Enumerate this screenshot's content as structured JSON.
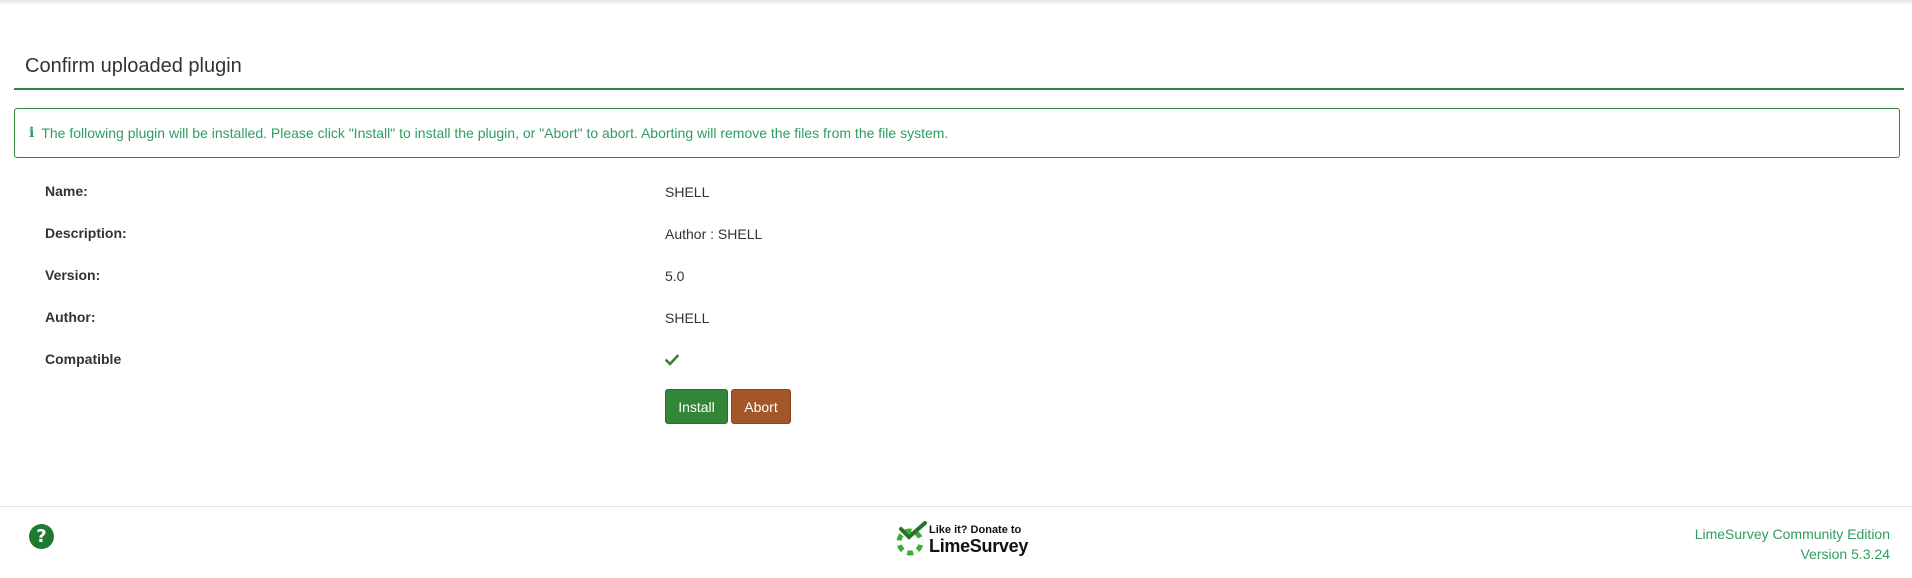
{
  "page": {
    "title": "Confirm uploaded plugin"
  },
  "alert": {
    "icon": "info-icon",
    "text": "The following plugin will be installed. Please click \"Install\" to install the plugin, or \"Abort\" to abort. Aborting will remove the files from the file system."
  },
  "plugin": {
    "fields": [
      {
        "label": "Name:",
        "value": "SHELL"
      },
      {
        "label": "Description:",
        "value": "Author : SHELL"
      },
      {
        "label": "Version:",
        "value": "5.0"
      },
      {
        "label": "Author:",
        "value": "SHELL"
      },
      {
        "label": "Compatible",
        "value_icon": "check-icon"
      }
    ]
  },
  "actions": {
    "install_label": "Install",
    "abort_label": "Abort"
  },
  "footer": {
    "help_icon": "question-circle-icon",
    "donate_line1": "Like it? Donate to",
    "donate_line2": "LimeSurvey",
    "edition": "LimeSurvey Community Edition",
    "version": "Version 5.3.24"
  },
  "colors": {
    "accent": "#328637",
    "alert_text": "#2e9d5f",
    "abort": "#a35628"
  }
}
